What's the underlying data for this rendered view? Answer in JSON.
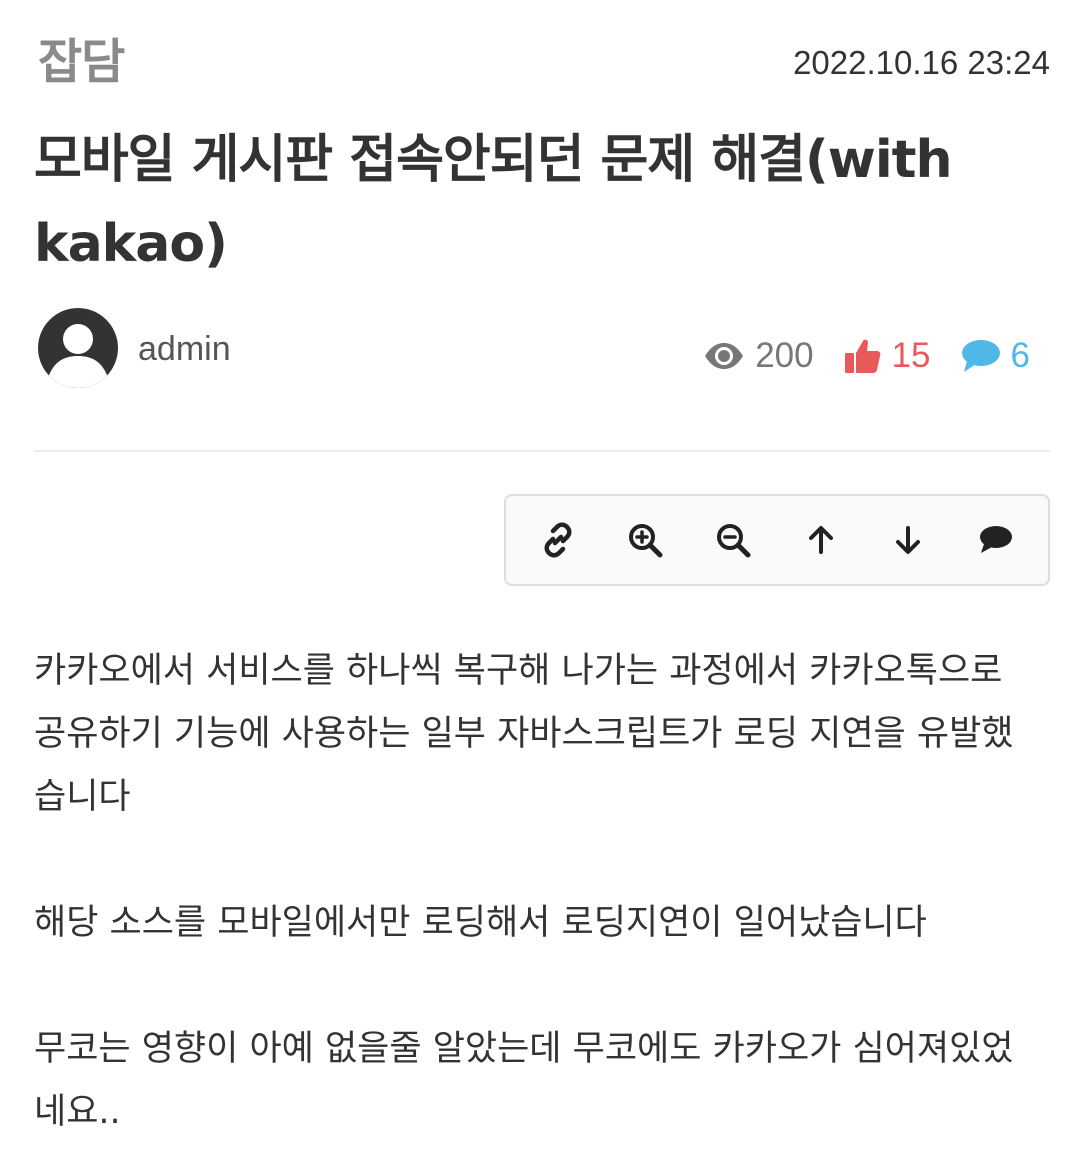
{
  "post": {
    "category": "잡담",
    "datetime": "2022.10.16 23:24",
    "title": "모바일 게시판 접속안되던 문제 해결(with kakao)",
    "author": "admin",
    "stats": {
      "views": "200",
      "likes": "15",
      "comments": "6"
    }
  },
  "toolbar": {
    "items": [
      {
        "name": "link-button",
        "icon": "link-icon"
      },
      {
        "name": "zoom-in-button",
        "icon": "zoom-in-icon"
      },
      {
        "name": "zoom-out-button",
        "icon": "zoom-out-icon"
      },
      {
        "name": "scroll-up-button",
        "icon": "arrow-up-icon"
      },
      {
        "name": "scroll-down-button",
        "icon": "arrow-down-icon"
      },
      {
        "name": "comment-button",
        "icon": "comment-icon"
      }
    ]
  },
  "content": {
    "paragraphs": [
      "카카오에서 서비스를 하나씩 복구해 나가는 과정에서 카카오톡으로 공유하기 기능에 사용하는 일부 자바스크립트가 로딩 지연을 유발했습니다",
      "해당 소스를 모바일에서만 로딩해서 로딩지연이 일어났습니다",
      "무코는 영향이 아예 없을줄 알았는데 무코에도 카카오가 심어져있었네요.."
    ]
  },
  "colors": {
    "category": "#8a8a8a",
    "text": "#333333",
    "likes": "#e85a5a",
    "comments": "#4fb8e6",
    "views": "#777777"
  }
}
